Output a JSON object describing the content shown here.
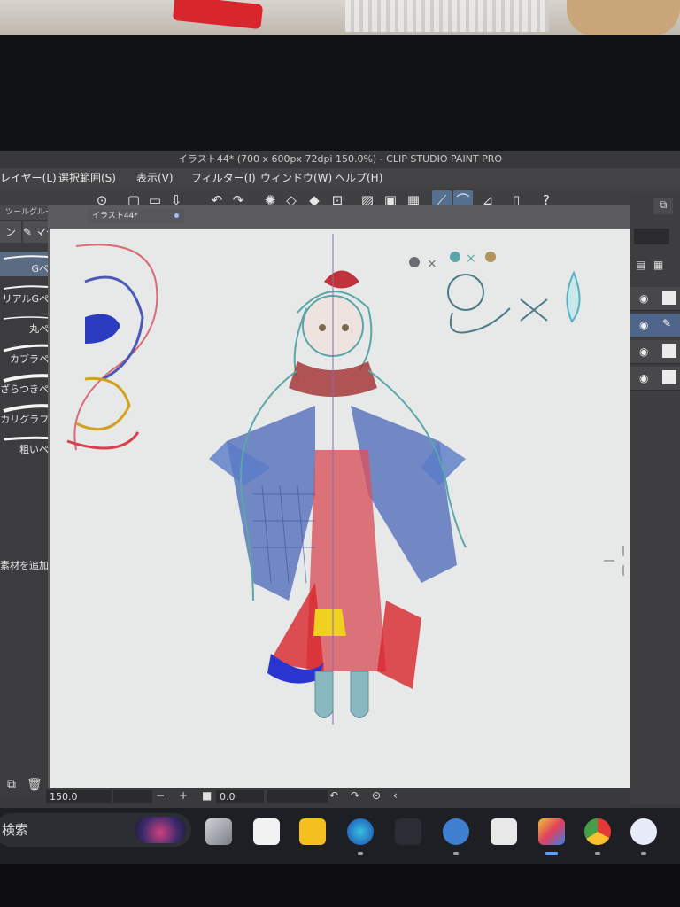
{
  "window": {
    "title": "イラスト44* (700 x 600px 72dpi 150.0%) - CLIP STUDIO PAINT PRO"
  },
  "menu": {
    "items": [
      "レイヤー(L)",
      "選択範囲(S)",
      "表示(V)",
      "フィルター(I)",
      "ウィンドウ(W)",
      "ヘルプ(H)"
    ]
  },
  "toolgroup": {
    "tab_label": "ツールグループ",
    "tab_left_icon": "pen-icon",
    "tab_right_label": "マーカー"
  },
  "brushes": [
    {
      "label": "Gペン"
    },
    {
      "label": "リアルGペン"
    },
    {
      "label": "丸ペン"
    },
    {
      "label": "カブラペン"
    },
    {
      "label": "ざらつきペン"
    },
    {
      "label": "カリグラフィ"
    },
    {
      "label": "粗いペン"
    }
  ],
  "add_material": "素材を追加する",
  "document_tab": {
    "label": "イラスト44*"
  },
  "statusbar": {
    "zoom": "150.0",
    "rotation": "0.0"
  },
  "taskbar": {
    "search_placeholder": "検索"
  },
  "colors": {
    "accent": "#55708f",
    "paper": "#e6e9e7",
    "ui_dark": "#3c3c3f"
  }
}
